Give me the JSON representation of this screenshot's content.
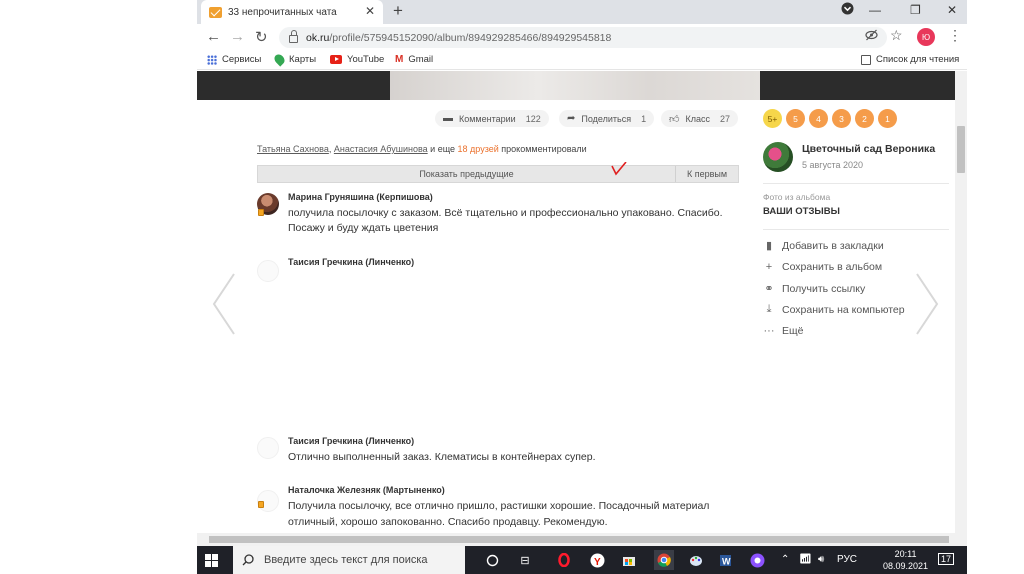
{
  "browser": {
    "tab": {
      "title": "33 непрочитанных чата",
      "close": "✕"
    },
    "new_tab": "+",
    "window_controls": {
      "minimize": "—",
      "restore": "❐",
      "close": "✕"
    },
    "url": {
      "host": "ok.ru",
      "path": "/profile/575945152090/album/894929285466/894929545818"
    },
    "profile_initials": "Ю",
    "bookmarks": [
      {
        "label": "Сервисы",
        "icon": "apps-icon"
      },
      {
        "label": "Карты",
        "icon": "maps-icon"
      },
      {
        "label": "YouTube",
        "icon": "youtube-icon"
      },
      {
        "label": "Gmail",
        "icon": "gmail-icon"
      }
    ],
    "reading_list": "Список для чтения"
  },
  "photo_stats": {
    "comments": {
      "label": "Комментарии",
      "count": "122"
    },
    "share": {
      "label": "Поделиться",
      "count": "1"
    },
    "like": {
      "label": "Класс",
      "count": "27"
    }
  },
  "mentions": {
    "user1": "Татьяна Сахнова",
    "sep": ",",
    "user2": "Анастасия Абушинова",
    "and_more": "и еще",
    "friends": "18 друзей",
    "tail": "прокомментировали"
  },
  "show_previous": "Показать предыдущие",
  "to_first": "К первым",
  "comments": [
    {
      "author": "Марина Груняшина (Керпишова)",
      "line1": "получила посылочку с заказом. Всё тщательно и профессионально упаковано. Спасибо.",
      "line2": "Посажу и буду ждать цветения"
    },
    {
      "author": "Таисия Гречкина (Линченко)",
      "line1": ""
    },
    {
      "author": "Таисия Гречкина (Линченко)",
      "line1": "Отлично выполненный заказ. Клематисы в контейнерах супер."
    },
    {
      "author": "Наталочка Железняк (Мартыненко)",
      "line1": "Получила посылочку, все отлично пришло, растишки хорошие. Посадочный материал",
      "line2": "отличный, хорошо запокованно. Спасибо продавцу. Рекомендую."
    }
  ],
  "sidebar": {
    "badges": [
      "5+",
      "5",
      "4",
      "3",
      "2",
      "1"
    ],
    "group_name": "Цветочный сад Вероника",
    "group_date": "5 августа 2020",
    "album_label": "Фото из альбома",
    "album_name": "ВАШИ ОТЗЫВЫ",
    "actions": [
      {
        "label": "Добавить в закладки",
        "icon": "bookmark-icon"
      },
      {
        "label": "Сохранить в альбом",
        "icon": "plus-icon"
      },
      {
        "label": "Получить ссылку",
        "icon": "link-icon"
      },
      {
        "label": "Сохранить на компьютер",
        "icon": "download-icon"
      },
      {
        "label": "Ещё",
        "icon": "more-icon"
      }
    ]
  },
  "taskbar": {
    "search_placeholder": "Введите здесь текст для поиска",
    "language": "РУС",
    "time": "20:11",
    "date": "08.09.2021",
    "notifications": "17"
  },
  "colors": {
    "accent_orange": "#eb722e",
    "badge_orange": "#f59c4a",
    "taskbar": "#1f2128"
  }
}
